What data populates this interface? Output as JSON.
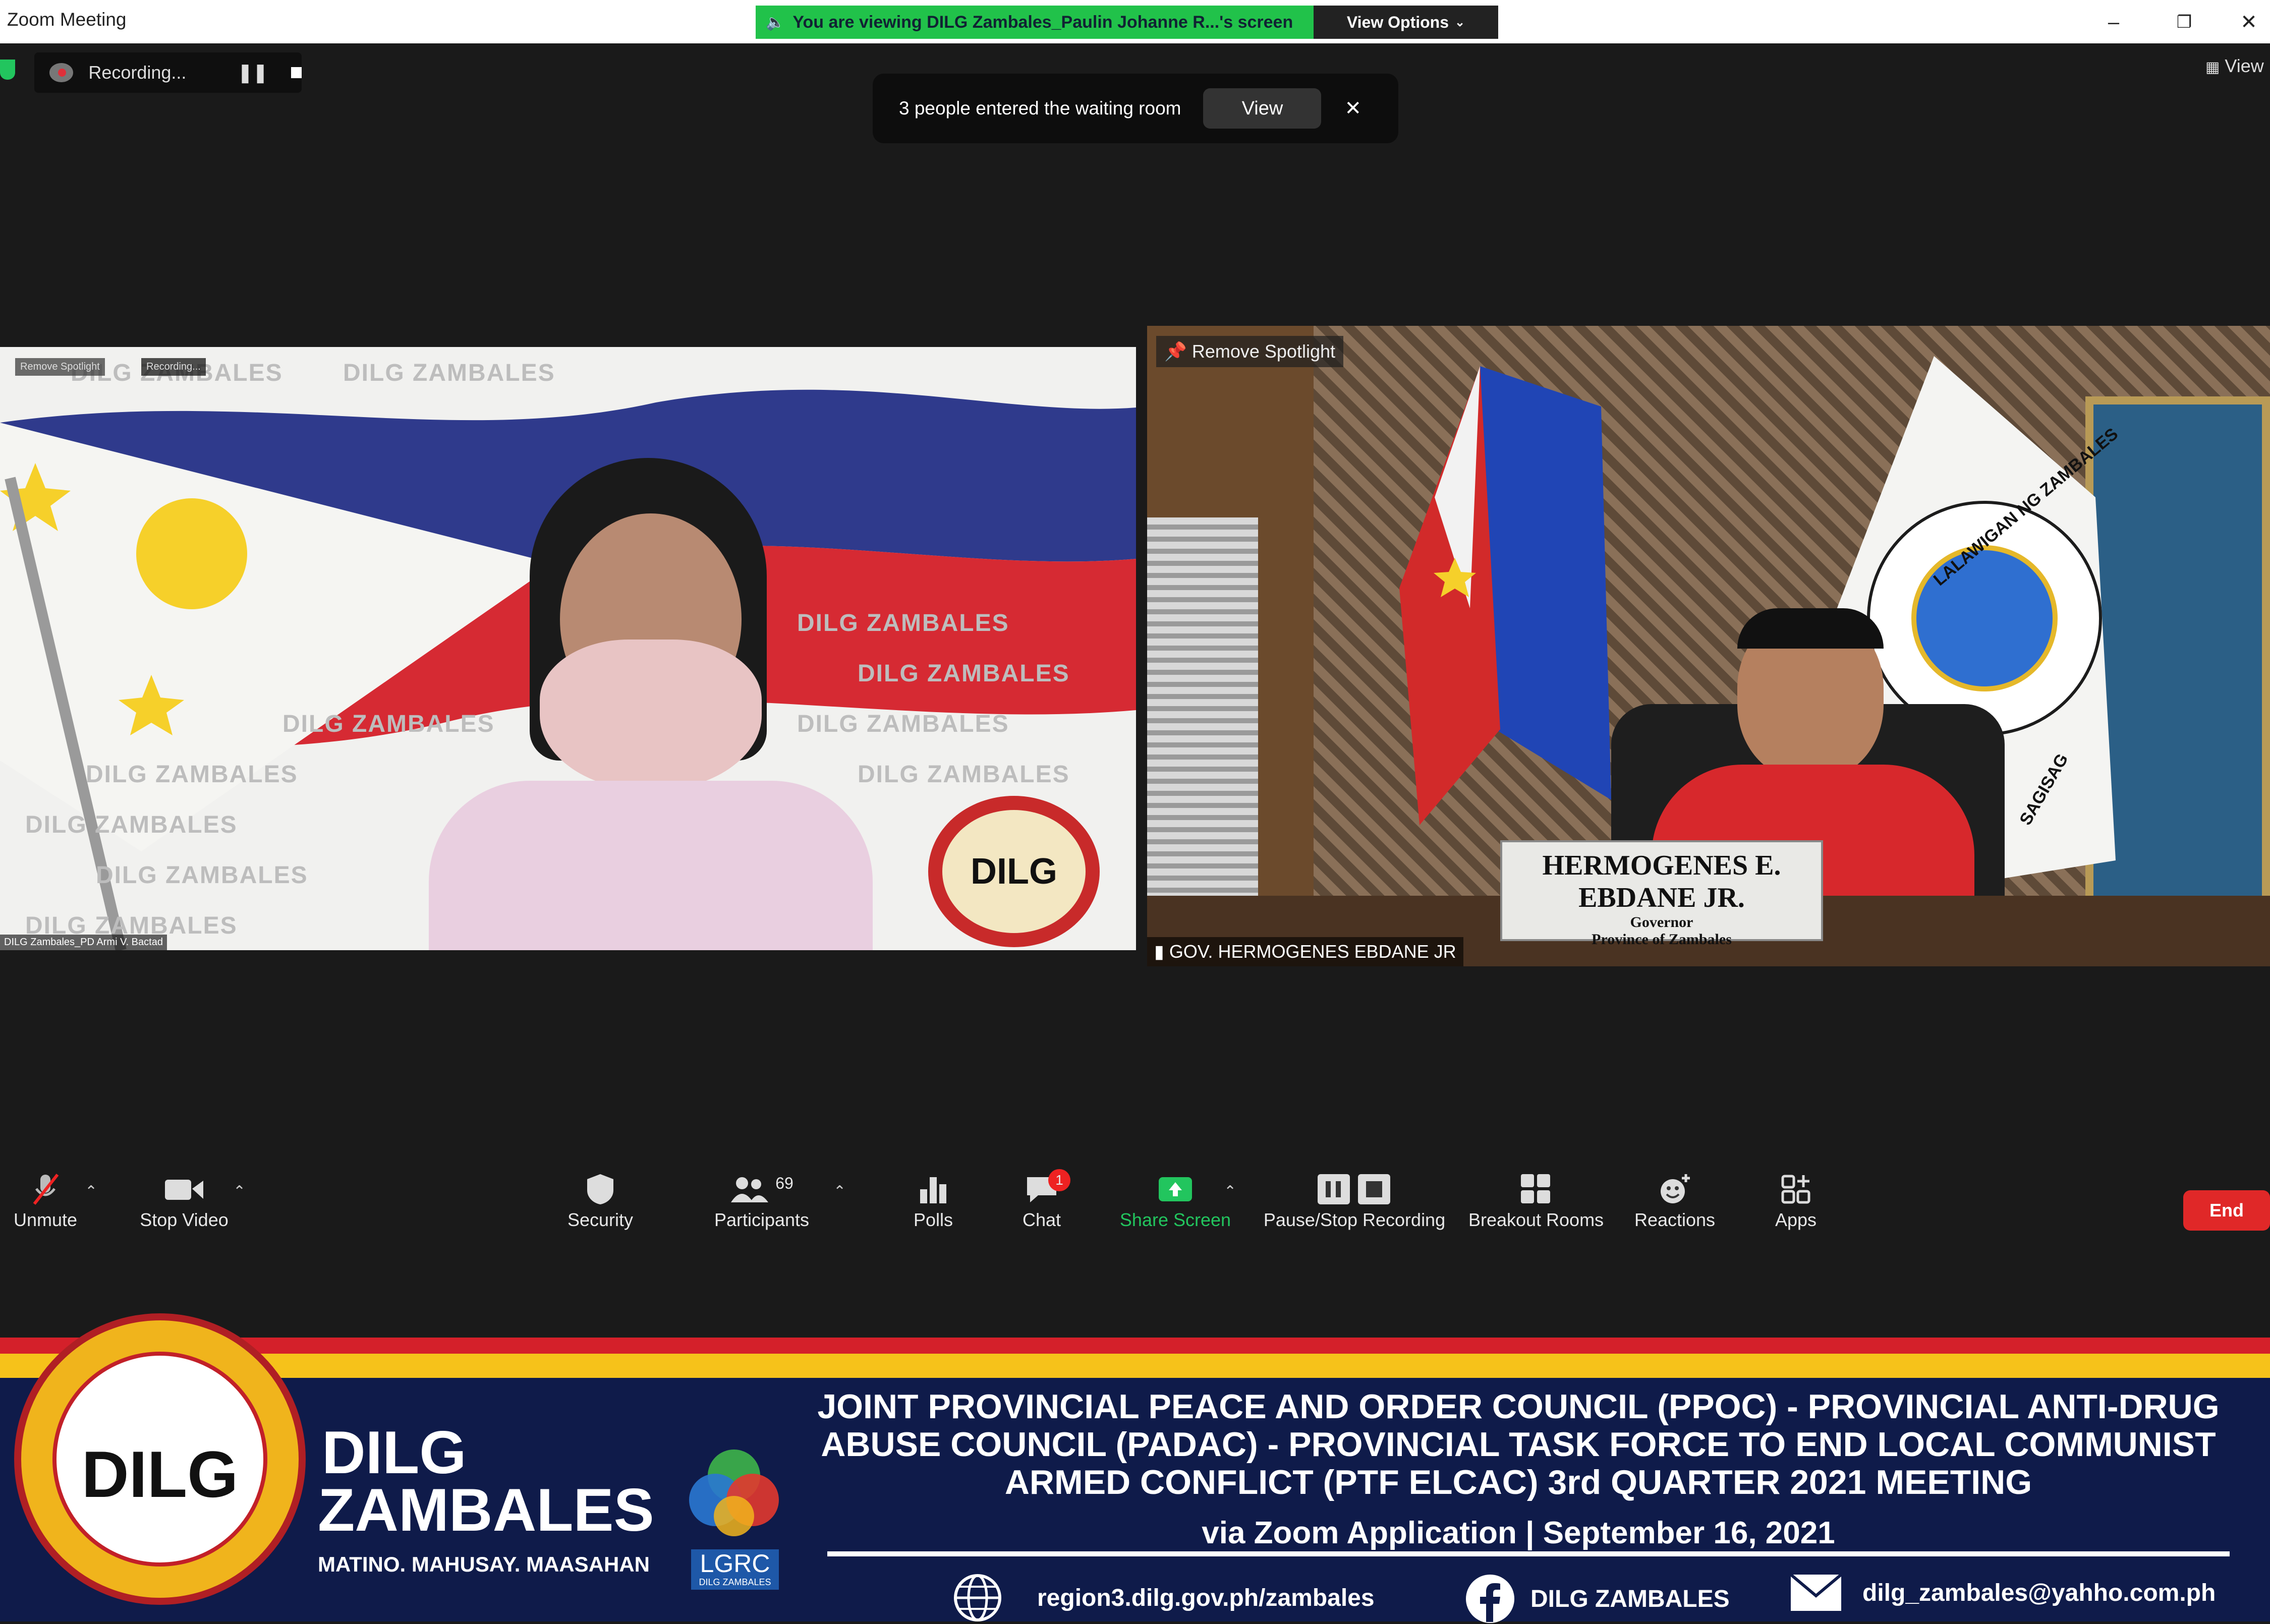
{
  "window": {
    "title": "Zoom Meeting",
    "share_banner": "You are viewing DILG Zambales_Paulin Johanne R...'s screen",
    "view_options": "View Options"
  },
  "recording": {
    "status": "Recording..."
  },
  "toast": {
    "message": "3 people entered the waiting room",
    "view_label": "View",
    "close_label": "✕"
  },
  "top_right_view": "View",
  "tiles": {
    "left": {
      "name": "DILG Zambales_PD Armi V. Bactad",
      "watermark": "DILG ZAMBALES",
      "mini_spotlight": "Remove Spotlight",
      "mini_recording": "Recording...",
      "badge": "DILG"
    },
    "right": {
      "spotlight": "Remove Spotlight",
      "name": "GOV. HERMOGENES EBDANE JR",
      "nameplate_name": "HERMOGENES E. EBDANE JR.",
      "nameplate_title": "Governor",
      "nameplate_sub": "Province of Zambales",
      "seal_text_top": "LALAWIGAN NG ZAMBALES",
      "seal_text_bottom": "SAGISAG"
    }
  },
  "toolbar": {
    "unmute": "Unmute",
    "stop_video": "Stop Video",
    "security": "Security",
    "participants": "Participants",
    "participants_count": "69",
    "polls": "Polls",
    "chat": "Chat",
    "chat_badge": "1",
    "share_screen": "Share Screen",
    "pause_stop_recording": "Pause/Stop Recording",
    "breakout_rooms": "Breakout Rooms",
    "reactions": "Reactions",
    "apps": "Apps",
    "end": "End"
  },
  "banner": {
    "org_line1": "DILG",
    "org_line2": "ZAMBALES",
    "motto": "MATINO. MAHUSAY. MAASAHAN",
    "seal_label": "DILG",
    "lgrc_label": "LGRC",
    "lgrc_sub": "DILG ZAMBALES",
    "event_title": "JOINT PROVINCIAL PEACE AND ORDER COUNCIL (PPOC) - PROVINCIAL ANTI-DRUG ABUSE COUNCIL (PADAC) - PROVINCIAL TASK FORCE TO END LOCAL COMMUNIST ARMED CONFLICT (PTF ELCAC) 3rd QUARTER 2021 MEETING",
    "event_sub": "via Zoom Application | September 16, 2021",
    "website": "region3.dilg.gov.ph/zambales",
    "facebook": "DILG ZAMBALES",
    "email": "dilg_zambales@yahho.com.ph"
  },
  "colors": {
    "share_green": "#21c24a",
    "end_red": "#e02828",
    "banner_navy": "#0f1b4a",
    "stripe_red": "#d4202a",
    "stripe_yellow": "#f6c21a"
  }
}
